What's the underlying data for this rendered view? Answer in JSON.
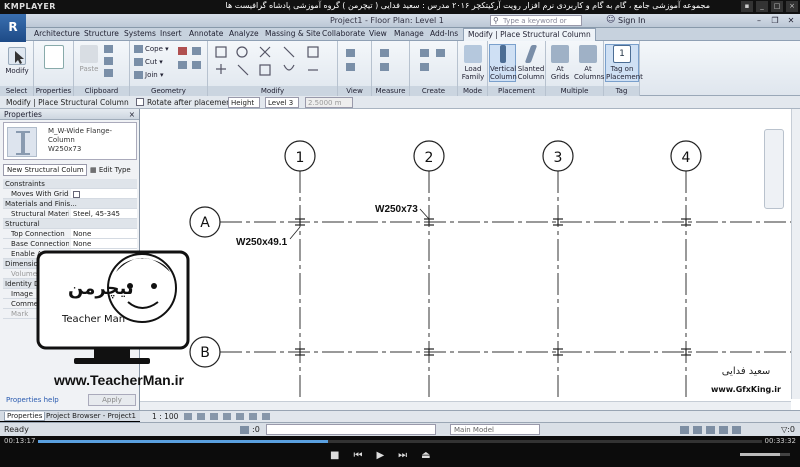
{
  "player": {
    "logo": "KMPLAYER",
    "title": "مجموعه آموزشی جامع ، گام به گام و کاربردی نرم افزار رویت آرکیتکچر ۲۰۱۶ مدرس : سعید فدایی ( تیچرمن ) گروه آموزشی پادشاه گرافیست ها",
    "time_elapsed": "00:13:17",
    "time_total": "00:33:32",
    "progress": 0.4,
    "volume": 0.8
  },
  "revit": {
    "app_button": "R",
    "title": "Project1 - Floor Plan: Level 1",
    "search_placeholder": "Type a keyword or phrase",
    "sign_in": "Sign In"
  },
  "ribbon": {
    "tabs": [
      "Architecture",
      "Structure",
      "Systems",
      "Insert",
      "Annotate",
      "Analyze",
      "Massing & Site",
      "Collaborate",
      "View",
      "Manage",
      "Add-Ins",
      "Modify | Place Structural Column"
    ],
    "groups": {
      "select": "Select",
      "properties": "Properties",
      "clipboard": "Clipboard",
      "geometry": "Geometry",
      "modify": "Modify",
      "view": "View",
      "measure": "Measure",
      "create": "Create",
      "mode": "Mode",
      "placement": "Placement",
      "multiple": "Multiple",
      "tag": "Tag"
    },
    "buttons": {
      "modify": "Modify",
      "paste": "Paste",
      "cope": "Cope",
      "cut": "Cut",
      "join": "Join",
      "load_family": "Load Family",
      "vertical_column": "Vertical Column",
      "slanted_column": "Slanted Column",
      "at_grids": "At Grids",
      "at_columns": "At Columns",
      "tag_on_placement": "Tag on Placement"
    }
  },
  "options_bar": {
    "context": "Modify | Place Structural Column",
    "rotate": "Rotate after placement",
    "height": "Height",
    "level": "Level 3",
    "offset": "2.5000 m"
  },
  "properties": {
    "header": "Properties",
    "type_name": "M_W-Wide Flange-Column",
    "type_size": "W250x73",
    "filter": "New Structural Colum",
    "edit_type": "Edit Type",
    "rows": [
      {
        "cat": "Constraints"
      },
      {
        "k": "Moves With Grids",
        "cb": true
      },
      {
        "cat": "Materials and Finis..."
      },
      {
        "k": "Structural Material",
        "v": "Steel, 45-345"
      },
      {
        "cat": "Structural"
      },
      {
        "k": "Top Connection",
        "v": "None"
      },
      {
        "k": "Base Connection",
        "v": "None"
      },
      {
        "k": "Enable Analytical",
        "cb": true
      },
      {
        "cat": "Dimensions"
      },
      {
        "k": "Volume",
        "v": "",
        "dim": true
      },
      {
        "cat": "Identity Data"
      },
      {
        "k": "Image",
        "v": ""
      },
      {
        "k": "Comments",
        "v": ""
      },
      {
        "k": "Mark",
        "v": "",
        "dim": true
      }
    ],
    "help": "Properties help",
    "apply": "Apply",
    "tab_properties": "Properties",
    "tab_browser": "Project Browser - Project1"
  },
  "drawing": {
    "grids_v": [
      "1",
      "2",
      "3",
      "4"
    ],
    "grids_h": [
      "A",
      "B"
    ],
    "label1": "W250x49.1",
    "label2": "W250x73"
  },
  "viewbar": {
    "scale": "1 : 100"
  },
  "statusbar": {
    "ready": "Ready",
    "zero": ":0",
    "model": "Main Model"
  },
  "overlays": {
    "teacherman_brand": "تیچرمن",
    "teacherman_sub": "Teacher Man",
    "teacherman_url": "www.TeacherMan.ir",
    "gfx_signature": "سعید فدایی",
    "gfx_url": "www.GfxKing.ir"
  },
  "colors": {
    "revit_blue": "#2a5a98",
    "grid_line": "#333333",
    "ribbon_bg": "#e8edf3"
  }
}
